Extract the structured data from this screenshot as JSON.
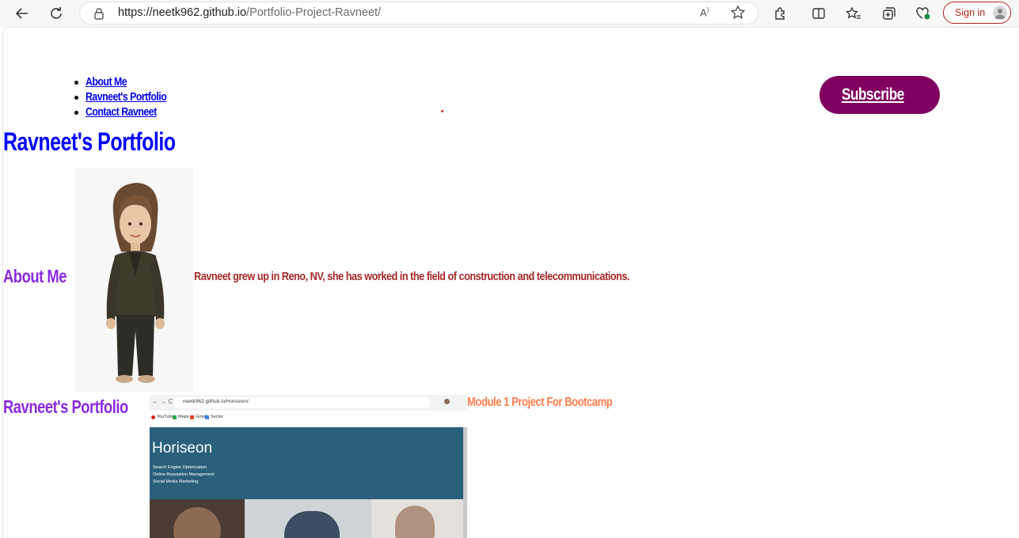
{
  "browser": {
    "url_host": "https://neetk962.github.io",
    "url_path": "/Portfolio-Project-Ravneet/",
    "read_aloud": "A",
    "sign_in_label": "Sign in"
  },
  "nav": {
    "items": [
      {
        "label": "About Me"
      },
      {
        "label": "Ravneet's Portfolio"
      },
      {
        "label": "Contact Ravneet"
      }
    ],
    "subscribe_label": "Subscribe"
  },
  "header": {
    "title": "Ravneet's Portfolio"
  },
  "about": {
    "heading": "About Me",
    "text": "Ravneet grew up in Reno, NV, she has worked in the field of construction and telecommunications."
  },
  "portfolio": {
    "heading": "Ravneet's Portfolio",
    "project_link": "Module 1 Project For Bootcamp",
    "screenshot": {
      "url": "neetk962.github.io/Horiseon/",
      "bookmarks": [
        "YouTube",
        "Maps",
        "Gmail",
        "Sector"
      ],
      "brand": "Horiseon",
      "menu": [
        "Search Engine Optimization",
        "Online Reputation Management",
        "Social Media Marketing"
      ]
    }
  },
  "colors": {
    "title": "#0000ff",
    "heading": "#8a2be2",
    "about_text": "#a52a2a",
    "project_link": "#ff7f50",
    "subscribe_bg": "#800060",
    "horiseon_header": "#2a607c"
  }
}
